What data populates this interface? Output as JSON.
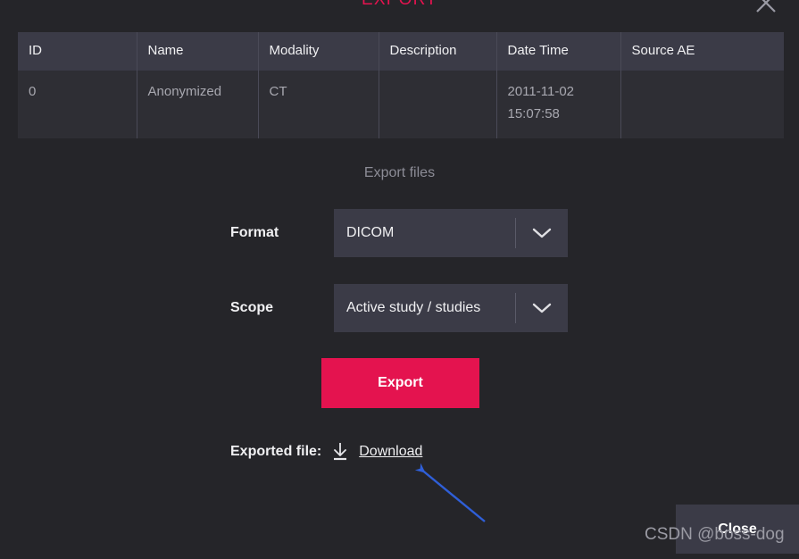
{
  "dialog": {
    "title": "EXPORT",
    "close_icon": "close-x-icon"
  },
  "table": {
    "columns": [
      "ID",
      "Name",
      "Modality",
      "Description",
      "Date Time",
      "Source AE"
    ],
    "rows": [
      {
        "id": "0",
        "name": "Anonymized",
        "modality": "CT",
        "description": "",
        "date_time": "2011-11-02\n15:07:58",
        "source_ae": ""
      }
    ]
  },
  "form": {
    "section_label": "Export files",
    "format": {
      "label": "Format",
      "value": "DICOM",
      "arrow_icon": "chevron-down-icon"
    },
    "scope": {
      "label": "Scope",
      "value": "Active study / studies",
      "arrow_icon": "chevron-down-icon"
    },
    "export_button": "Export"
  },
  "exported": {
    "label": "Exported file:",
    "icon": "download-icon",
    "link": "Download"
  },
  "footer": {
    "close_button": "Close"
  },
  "watermark": {
    "text": "CSDN @boss-dog"
  },
  "colors": {
    "background": "#252529",
    "accent": "#e4134f",
    "table_header": "#3b3b47",
    "table_row": "#2e2e34",
    "field_bg": "#3b3b47",
    "annotation_arrow": "#2f5fd8"
  }
}
